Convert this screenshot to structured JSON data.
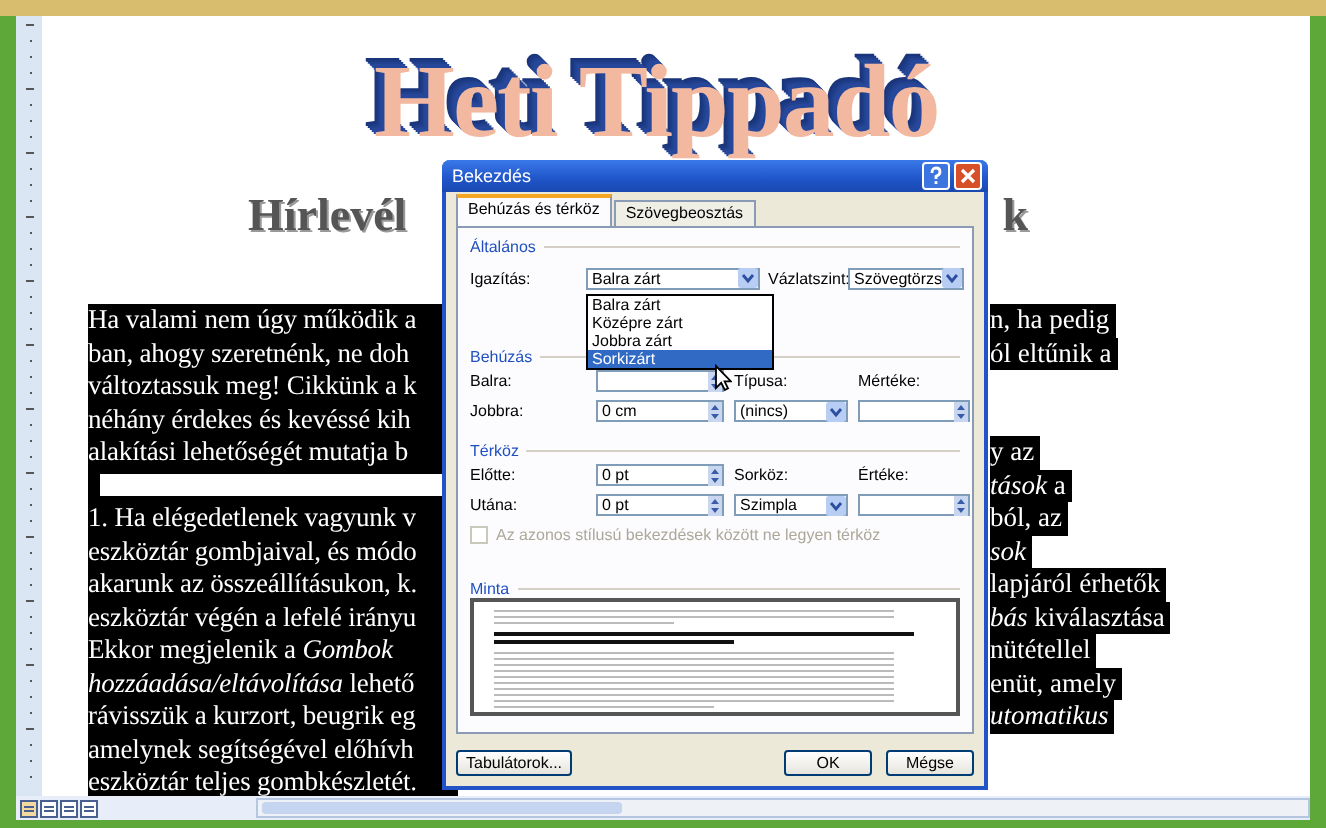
{
  "document": {
    "title": "Heti Tippadó",
    "subtitle_left": "Hírlevél",
    "subtitle_right": "k",
    "lines": [
      {
        "kind": "text",
        "left": "Ha valami nem úgy működik a",
        "right": "n, ha pedig"
      },
      {
        "kind": "text",
        "left": "ban, ahogy szeretnénk, ne doh",
        "right": "ól eltűnik a"
      },
      {
        "kind": "text",
        "left": "változtassuk meg! Cikkünk a k"
      },
      {
        "kind": "text",
        "left": "néhány érdekes és kevéssé kih"
      },
      {
        "kind": "text",
        "left": "alakítási lehetőségét mutatja b",
        "right": "y az"
      },
      {
        "kind": "box",
        "right": "*tások* a"
      },
      {
        "kind": "text",
        "left": "1. Ha elégedetlenek vagyunk v",
        "right": "ból, az"
      },
      {
        "kind": "text",
        "left": "eszköztár gombjaival, és módo",
        "right": "*sok*"
      },
      {
        "kind": "text",
        "left": "akarunk az összeállításukon, k.",
        "right": "lapjáról érhetők"
      },
      {
        "kind": "text",
        "left": "eszköztár végén a lefelé irányu",
        "right": "*bás* kiválasztása"
      },
      {
        "kind": "text",
        "left": "Ekkor megjelenik a *Gombok*",
        "right": "nütétellel"
      },
      {
        "kind": "text",
        "left": "*hozzáadása/eltávolítása* lehető",
        "right": "enüt, amely"
      },
      {
        "kind": "text",
        "left": "rávisszük a kurzort, beugrik eg",
        "right": "*utomatikus*"
      },
      {
        "kind": "text",
        "left": "amelynek segítségével előhívh"
      },
      {
        "kind": "text",
        "left": "eszköztár teljes gombkészletét."
      }
    ]
  },
  "dialog": {
    "title": "Bekezdés",
    "tabs": [
      {
        "label": "Behúzás és térköz",
        "selected": true
      },
      {
        "label": "Szövegbeosztás",
        "selected": false
      }
    ],
    "general": {
      "heading": "Általános",
      "alignment": {
        "label": "Igazítás:",
        "value": "Balra zárt"
      },
      "outline": {
        "label": "Vázlatszint:",
        "value": "Szövegtörzs"
      },
      "alignment_options": [
        {
          "label": "Balra zárt",
          "selected": false
        },
        {
          "label": "Középre zárt",
          "selected": false
        },
        {
          "label": "Jobbra zárt",
          "selected": false
        },
        {
          "label": "Sorkizárt",
          "selected": true
        }
      ]
    },
    "indent": {
      "heading": "Behúzás",
      "left": {
        "label": "Balra:"
      },
      "right": {
        "label": "Jobbra:",
        "value": "0 cm"
      },
      "type": {
        "label": "Típusa:",
        "value": "(nincs)"
      },
      "by": {
        "label": "Mértéke:"
      }
    },
    "spacing": {
      "heading": "Térköz",
      "before": {
        "label": "Előtte:",
        "value": "0 pt"
      },
      "after": {
        "label": "Utána:",
        "value": "0 pt"
      },
      "line": {
        "label": "Sorköz:",
        "value": "Szimpla"
      },
      "at": {
        "label": "Értéke:"
      },
      "option": {
        "label": "Az azonos stílusú bekezdések között ne legyen térköz",
        "checked": false,
        "disabled": true
      }
    },
    "preview": {
      "heading": "Minta"
    },
    "buttons": [
      "Tabulátorok...",
      "OK",
      "Mégse"
    ]
  }
}
